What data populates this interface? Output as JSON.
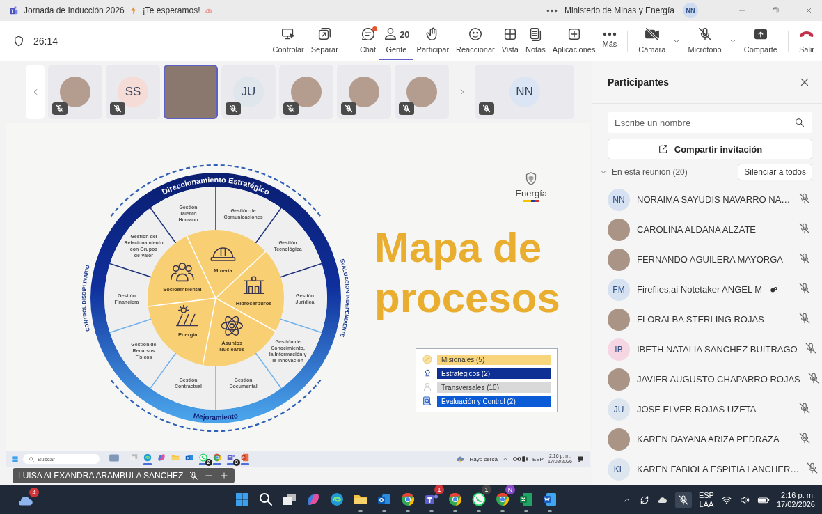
{
  "title_bar": {
    "title": "Jornada de Inducción 2026",
    "subtitle": "¡Te esperamos!",
    "organization": "Ministerio de Minas y Energía",
    "user_initials": "NN"
  },
  "meeting": {
    "timer": "26:14"
  },
  "toolbar": [
    {
      "kind": "control",
      "label": "Controlar",
      "selected": false
    },
    {
      "kind": "popout",
      "label": "Separar",
      "selected": false
    },
    {
      "kind": "chat",
      "label": "Chat",
      "selected": false,
      "divider_before": true,
      "notification": true
    },
    {
      "kind": "people",
      "label": "Gente",
      "selected": true,
      "count": "20"
    },
    {
      "kind": "hand",
      "label": "Participar",
      "selected": false
    },
    {
      "kind": "react",
      "label": "Reaccionar",
      "selected": false
    },
    {
      "kind": "view",
      "label": "Vista",
      "selected": false
    },
    {
      "kind": "notes",
      "label": "Notas",
      "selected": false
    },
    {
      "kind": "apps",
      "label": "Aplicaciones",
      "selected": false
    },
    {
      "kind": "more",
      "label": "Más",
      "selected": false
    },
    {
      "kind": "camera",
      "label": "Cámara",
      "selected": false,
      "divider_before": true,
      "dropdown": true
    },
    {
      "kind": "mic",
      "label": "Micrófono",
      "selected": false,
      "dropdown": true
    },
    {
      "kind": "share",
      "label": "Comparte",
      "selected": false
    },
    {
      "kind": "leave",
      "label": "Salir",
      "selected": false,
      "divider_before": true
    }
  ],
  "video_strip": {
    "tiles": [
      {
        "kind": "photo",
        "muted": true,
        "selected": false
      },
      {
        "kind": "initials",
        "initials": "SS",
        "color": "#f6dcd6",
        "muted": true,
        "selected": false
      },
      {
        "kind": "video",
        "muted": false,
        "selected": true
      },
      {
        "kind": "initials",
        "initials": "JU",
        "color": "#dfe6ec",
        "muted": true,
        "selected": false
      },
      {
        "kind": "photo",
        "muted": true,
        "selected": false
      },
      {
        "kind": "photo",
        "muted": true,
        "selected": false
      },
      {
        "kind": "photo",
        "muted": true,
        "selected": false
      }
    ],
    "pinned": {
      "kind": "initials",
      "initials": "NN",
      "color": "#dbe5f3",
      "muted": true,
      "selected": false
    }
  },
  "shared_screen": {
    "slide": {
      "wheel": {
        "top_label": "Direccionamiento Estratégico",
        "bottom_label": "Mejoramiento",
        "left_label": "CONTROL DISCIPLINARIO",
        "right_label": "EVALUACION INDEPENDIENTE",
        "left_segments": [
          {
            "lines": [
              "Gestión",
              "Talento",
              "Humano"
            ]
          },
          {
            "lines": [
              "Gestión del",
              "Relacionamiento",
              "con Grupos",
              "de Valor"
            ]
          },
          {
            "lines": [
              "Gestión",
              "Financiera"
            ]
          },
          {
            "lines": [
              "Gestión de",
              "Recursos",
              "Físicos"
            ]
          },
          {
            "lines": [
              "Gestión",
              "Contractual"
            ]
          }
        ],
        "right_segments": [
          {
            "lines": [
              "Gestión de",
              "Comunicaciones"
            ]
          },
          {
            "lines": [
              "Gestión",
              "Tecnológica"
            ]
          },
          {
            "lines": [
              "Gestión",
              "Jurídica"
            ]
          },
          {
            "lines": [
              "Gestión de",
              "Conocimiento,",
              "la Información y",
              "la Innovación"
            ]
          },
          {
            "lines": [
              "Gestión",
              "Documental"
            ]
          }
        ],
        "core": [
          {
            "kind": "mining",
            "lines": [
              "Minería"
            ]
          },
          {
            "kind": "hydrocarbons",
            "lines": [
              "Hidrocarburos"
            ]
          },
          {
            "kind": "nuclear",
            "lines": [
              "Asuntos",
              "Nucleares"
            ]
          },
          {
            "kind": "energy",
            "lines": [
              "Energía"
            ]
          },
          {
            "kind": "social",
            "lines": [
              "Socioambiental"
            ]
          }
        ]
      },
      "logo": "Energía",
      "title_lines": [
        "Mapa de",
        "procesos"
      ],
      "legend": [
        {
          "kind": "mission",
          "label": "Misionales (5)",
          "color": "#f8d47c"
        },
        {
          "kind": "strategy",
          "label": "Estratégicos (2)",
          "color": "#0e2f94"
        },
        {
          "kind": "transversal",
          "label": "Transversales (10)",
          "color": "#d9d9d9"
        },
        {
          "kind": "evaluation",
          "label": "Evaluación y Control (2)",
          "color": "#0b5ad6"
        }
      ]
    },
    "taskbar": {
      "search": "Buscar",
      "apps": [
        {
          "kind": "thumbnail",
          "running": false
        },
        {
          "kind": "taskview",
          "running": false
        },
        {
          "kind": "edge",
          "running": true
        },
        {
          "kind": "copilot",
          "running": false
        },
        {
          "kind": "files",
          "running": false
        },
        {
          "kind": "outlook",
          "running": false
        },
        {
          "kind": "whatsapp",
          "running": true,
          "badge": "2"
        },
        {
          "kind": "chrome",
          "running": true
        },
        {
          "kind": "teams",
          "running": true,
          "badge": "3"
        },
        {
          "kind": "slides",
          "running": true
        }
      ],
      "weather": "Rayo cerca",
      "language": "ESP",
      "time": "2:16 p. m.",
      "date": "17/02/2026"
    },
    "presenter": {
      "name": "LUISA ALEXANDRA ARAMBULA SANCHEZ",
      "muted": true
    }
  },
  "panel": {
    "title": "Participantes",
    "search_placeholder": "Escribe un nombre",
    "share_button": "Compartir invitación",
    "section": {
      "label": "En esta reunión (20)",
      "expanded": true
    },
    "mute_all": "Silenciar a todos",
    "people": [
      {
        "kind": "initials",
        "initials": "NN",
        "color": "#d6e2f2",
        "name": "NORAIMA SAYUDIS NAVARRO NA…",
        "muted": true,
        "bot": false
      },
      {
        "kind": "photo",
        "name": "CAROLINA ALDANA ALZATE",
        "muted": true,
        "bot": false
      },
      {
        "kind": "photo",
        "name": "FERNANDO AGUILERA MAYORGA",
        "muted": true,
        "bot": false
      },
      {
        "kind": "initials",
        "initials": "FM",
        "color": "#d6e2f2",
        "name": "Fireflies.ai Notetaker ANGEL M",
        "muted": true,
        "bot": true
      },
      {
        "kind": "photo",
        "name": "FLORALBA STERLING ROJAS",
        "muted": true,
        "bot": false
      },
      {
        "kind": "initials",
        "initials": "IB",
        "color": "#f6d6e2",
        "name": "IBETH NATALIA SANCHEZ BUITRAGO",
        "muted": true,
        "bot": false
      },
      {
        "kind": "photo",
        "name": "JAVIER AUGUSTO CHAPARRO ROJAS",
        "muted": true,
        "bot": false
      },
      {
        "kind": "initials",
        "initials": "JU",
        "color": "#dde6ee",
        "name": "JOSE ELVER ROJAS UZETA",
        "muted": true,
        "bot": false
      },
      {
        "kind": "photo",
        "name": "KAREN DAYANA ARIZA PEDRAZA",
        "muted": true,
        "bot": false
      },
      {
        "kind": "initials",
        "initials": "KL",
        "color": "#dde6ee",
        "name": "KAREN FABIOLA ESPITIA LANCHER…",
        "muted": true,
        "bot": false
      }
    ]
  },
  "taskbar": {
    "weather_badge": "4",
    "apps": [
      {
        "kind": "start",
        "running": false
      },
      {
        "kind": "search",
        "running": false
      },
      {
        "kind": "taskview",
        "running": false
      },
      {
        "kind": "copilot",
        "running": false
      },
      {
        "kind": "edge",
        "running": false
      },
      {
        "kind": "files",
        "running": true
      },
      {
        "kind": "outlook",
        "running": true
      },
      {
        "kind": "chrome",
        "running": true
      },
      {
        "kind": "teams",
        "running": true,
        "badge": "1",
        "color": "#d13438"
      },
      {
        "kind": "chrome",
        "running": true
      },
      {
        "kind": "whatsapp",
        "running": true,
        "badge": "1",
        "color": "#444444"
      },
      {
        "kind": "chrome",
        "running": true,
        "badge": "N",
        "color": "#8a4bc8"
      },
      {
        "kind": "excel",
        "running": true
      },
      {
        "kind": "word",
        "running": true
      }
    ],
    "language": "ESP",
    "keyboard": "LAA",
    "time": "2:16 p. m.",
    "date": "17/02/2026"
  }
}
